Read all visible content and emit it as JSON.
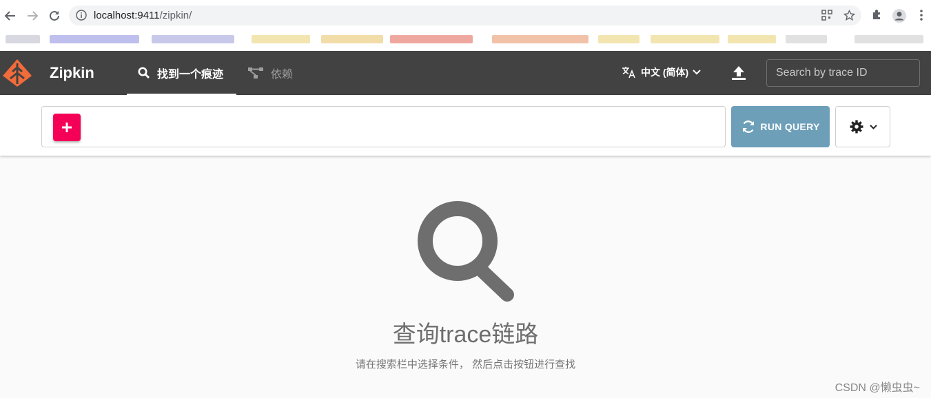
{
  "browser": {
    "url_host": "localhost:9411",
    "url_path": "/zipkin/"
  },
  "header": {
    "brand": "Zipkin",
    "tabs": [
      {
        "label": "找到一个痕迹",
        "icon": "search-icon",
        "active": true
      },
      {
        "label": "依赖",
        "icon": "dependency-graph-icon",
        "active": false
      }
    ],
    "language": "中文 (简体)",
    "trace_search_placeholder": "Search by trace ID"
  },
  "query": {
    "run_label": "RUN QUERY"
  },
  "empty_state": {
    "title": "查询trace链路",
    "subtitle": "请在搜索栏中选择条件， 然后点击按钮进行查找"
  },
  "watermark": "CSDN @懒虫虫~",
  "colors": {
    "header_bg": "#424242",
    "add_button": "#f50057",
    "run_button": "#6d9fb9",
    "logo": "#f26b3a"
  }
}
